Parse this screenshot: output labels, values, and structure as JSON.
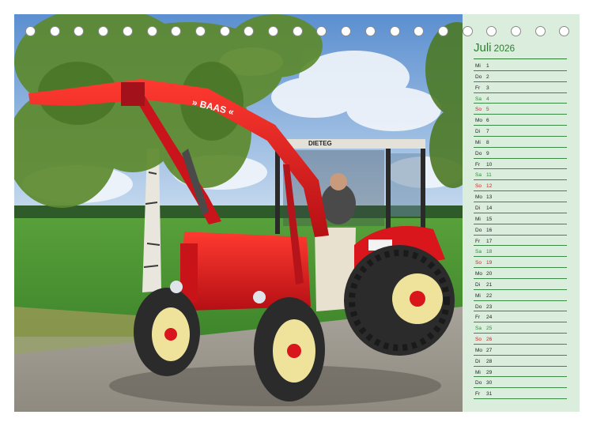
{
  "calendar": {
    "month": "Juli",
    "year": "2026",
    "days": [
      {
        "day": "Mi",
        "num": "1",
        "type": "weekday"
      },
      {
        "day": "Do",
        "num": "2",
        "type": "weekday"
      },
      {
        "day": "Fr",
        "num": "3",
        "type": "weekday"
      },
      {
        "day": "Sa",
        "num": "4",
        "type": "saturday"
      },
      {
        "day": "So",
        "num": "5",
        "type": "sunday"
      },
      {
        "day": "Mo",
        "num": "6",
        "type": "weekday"
      },
      {
        "day": "Di",
        "num": "7",
        "type": "weekday"
      },
      {
        "day": "Mi",
        "num": "8",
        "type": "weekday"
      },
      {
        "day": "Do",
        "num": "9",
        "type": "weekday"
      },
      {
        "day": "Fr",
        "num": "10",
        "type": "weekday"
      },
      {
        "day": "Sa",
        "num": "11",
        "type": "saturday"
      },
      {
        "day": "So",
        "num": "12",
        "type": "sunday"
      },
      {
        "day": "Mo",
        "num": "13",
        "type": "weekday"
      },
      {
        "day": "Di",
        "num": "14",
        "type": "weekday"
      },
      {
        "day": "Mi",
        "num": "15",
        "type": "weekday"
      },
      {
        "day": "Do",
        "num": "16",
        "type": "weekday"
      },
      {
        "day": "Fr",
        "num": "17",
        "type": "weekday"
      },
      {
        "day": "Sa",
        "num": "18",
        "type": "saturday"
      },
      {
        "day": "So",
        "num": "19",
        "type": "sunday"
      },
      {
        "day": "Mo",
        "num": "20",
        "type": "weekday"
      },
      {
        "day": "Di",
        "num": "21",
        "type": "weekday"
      },
      {
        "day": "Mi",
        "num": "22",
        "type": "weekday"
      },
      {
        "day": "Do",
        "num": "23",
        "type": "weekday"
      },
      {
        "day": "Fr",
        "num": "24",
        "type": "weekday"
      },
      {
        "day": "Sa",
        "num": "25",
        "type": "saturday"
      },
      {
        "day": "So",
        "num": "26",
        "type": "sunday"
      },
      {
        "day": "Mo",
        "num": "27",
        "type": "weekday"
      },
      {
        "day": "Di",
        "num": "28",
        "type": "weekday"
      },
      {
        "day": "Mi",
        "num": "29",
        "type": "weekday"
      },
      {
        "day": "Do",
        "num": "30",
        "type": "weekday"
      },
      {
        "day": "Fr",
        "num": "31",
        "type": "weekday"
      }
    ]
  },
  "photo": {
    "loader_brand": "» BAAS «",
    "cab_brand": "DIETEG"
  },
  "colors": {
    "panel_background": "#dbeedd",
    "accent_green": "#2e7d32",
    "saturday": "#2e8b3a",
    "sunday": "#cc2222",
    "tractor_red": "#d8161b",
    "rim_cream": "#efe39b"
  }
}
